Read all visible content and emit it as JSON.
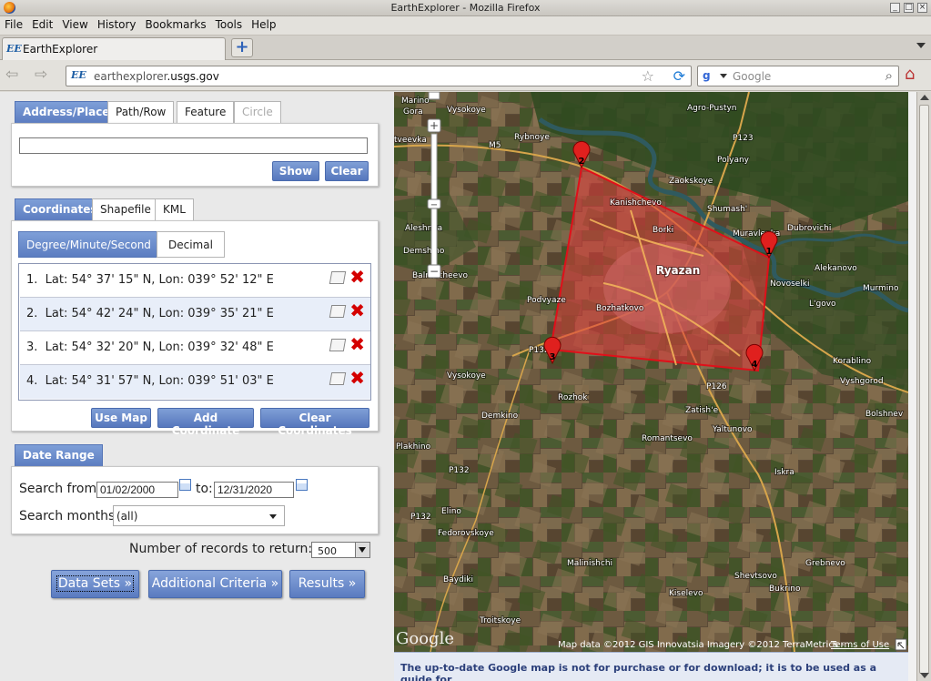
{
  "window": {
    "title": "EarthExplorer - Mozilla Firefox"
  },
  "menu": [
    "File",
    "Edit",
    "View",
    "History",
    "Bookmarks",
    "Tools",
    "Help"
  ],
  "tab": {
    "icon": "EE",
    "label": "EarthExplorer"
  },
  "url": {
    "icon": "EE",
    "domain": "earthexplorer",
    "tld": ".usgs.gov"
  },
  "search": {
    "placeholder": "Google"
  },
  "search_tabs": [
    "Address/Place",
    "Path/Row",
    "Feature",
    "Circle"
  ],
  "search_buttons": {
    "show": "Show",
    "clear": "Clear"
  },
  "coord_tabs": [
    "Coordinates",
    "Shapefile",
    "KML"
  ],
  "format_tabs": [
    "Degree/Minute/Second",
    "Decimal"
  ],
  "coordinates": [
    {
      "n": "1.",
      "text": "Lat: 54° 37' 15\" N, Lon: 039° 52' 12\" E"
    },
    {
      "n": "2.",
      "text": "Lat: 54° 42' 24\" N, Lon: 039° 35' 21\" E"
    },
    {
      "n": "3.",
      "text": "Lat: 54° 32' 20\" N, Lon: 039° 32' 48\" E"
    },
    {
      "n": "4.",
      "text": "Lat: 54° 31' 57\" N, Lon: 039° 51' 03\" E"
    }
  ],
  "coord_buttons": {
    "use_map": "Use Map",
    "add": "Add Coordinate",
    "clear": "Clear Coordinates"
  },
  "date_range": {
    "title": "Date Range",
    "from_label": "Search from:",
    "from": "01/02/2000",
    "to_label": "to:",
    "to": "12/31/2020",
    "months_label": "Search months:",
    "months": "(all)"
  },
  "records": {
    "label": "Number of records to return:",
    "value": "500"
  },
  "nav_buttons": {
    "datasets": "Data Sets »",
    "criteria": "Additional Criteria »",
    "results": "Results »"
  },
  "map": {
    "places": [
      "Marino",
      "Gora",
      "Vysokoye",
      "Agro-Pustyn",
      "Rybnoye",
      "Polyany",
      "tveevka",
      "M5",
      "P123",
      "Zaokskoye",
      "Kanishchevo",
      "Shumash'",
      "Dubrovichi",
      "Aleshnya",
      "Borki",
      "Ryazan",
      "Novoselki",
      "Alekanovo",
      "Muravlenka",
      "Demshino",
      "Balmacheevo",
      "Podvyaze",
      "Bozhatkovo",
      "Murmino",
      "L'govo",
      "P132",
      "Vysokoye",
      "Korablino",
      "Rozhok",
      "Vyshgorod",
      "P126",
      "Zatish'e",
      "Demkino",
      "Yaltunovo",
      "Bolshnev",
      "Romantsevo",
      "Plakhino",
      "P132",
      "Iskra",
      "Elino",
      "Fedorovskoye",
      "P132",
      "Shevtsovo",
      "Malinishchi",
      "Grebnevo",
      "Baydiki",
      "Bukrino",
      "Kiselevo",
      "Troitskoye"
    ],
    "markers": [
      "1",
      "2",
      "3",
      "4"
    ],
    "attribution": "Map data ©2012 GIS Innovatsia Imagery ©2012 TerraMetrics -",
    "terms": "Terms of Use",
    "logo": "Google"
  },
  "footnote": "The up-to-date Google map is not for purchase or for download; it is to be used as a guide for"
}
